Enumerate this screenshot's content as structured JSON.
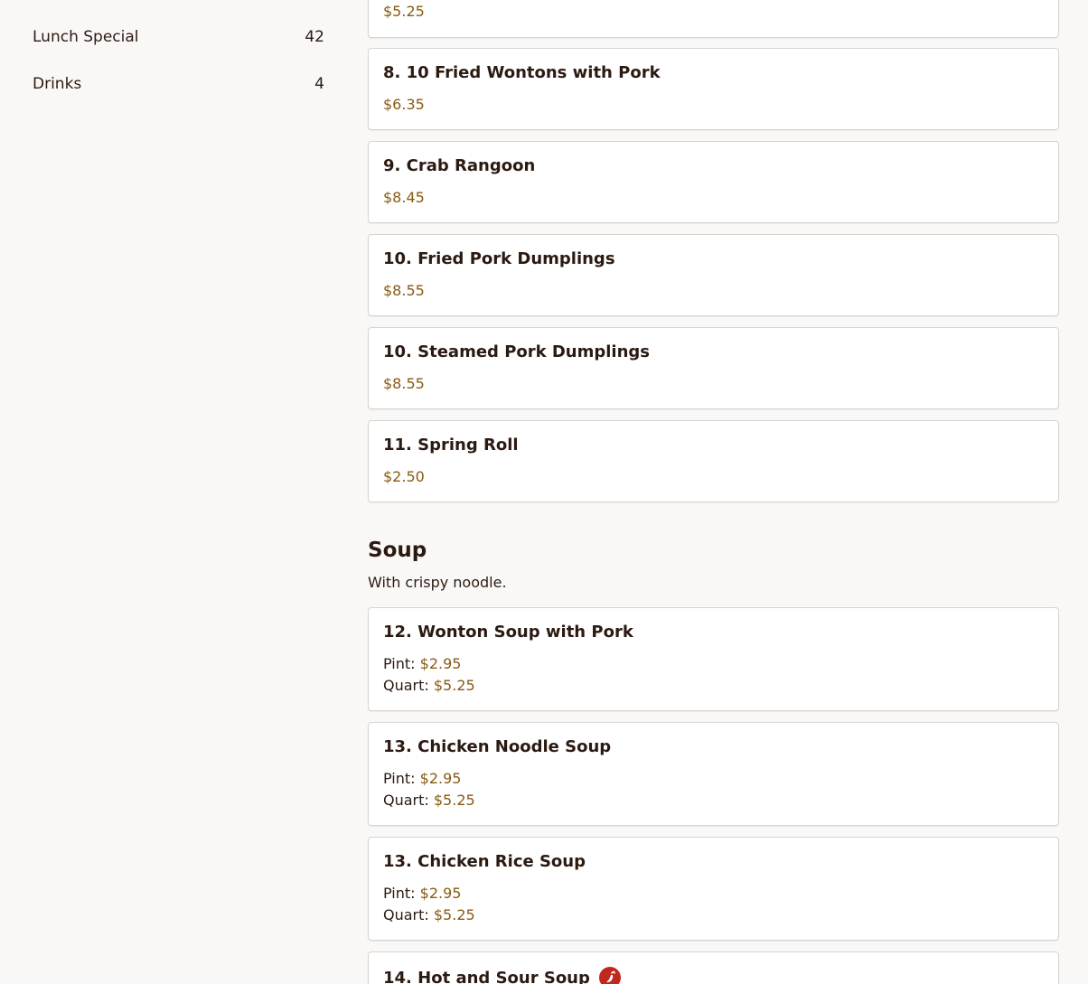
{
  "sidebar": {
    "items": [
      {
        "label": "Lunch Special",
        "count": "42"
      },
      {
        "label": "Drinks",
        "count": "4"
      }
    ]
  },
  "main": {
    "top_partial_price": "$5.25",
    "appetizer_items": [
      {
        "title": "8. 10 Fried Wontons with Pork",
        "price": "$6.35"
      },
      {
        "title": "9. Crab Rangoon",
        "price": "$8.45"
      },
      {
        "title": "10. Fried Pork Dumplings",
        "price": "$8.55"
      },
      {
        "title": "10. Steamed Pork Dumplings",
        "price": "$8.55"
      },
      {
        "title": "11. Spring Roll",
        "price": "$2.50"
      }
    ],
    "soup_section": {
      "title": "Soup",
      "subtitle": "With crispy noodle."
    },
    "soup_items": [
      {
        "title": "12. Wonton Soup with Pork",
        "pint_label": "Pint:",
        "pint_price": "$2.95",
        "quart_label": "Quart:",
        "quart_price": "$5.25"
      },
      {
        "title": "13. Chicken Noodle Soup",
        "pint_label": "Pint:",
        "pint_price": "$2.95",
        "quart_label": "Quart:",
        "quart_price": "$5.25"
      },
      {
        "title": "13. Chicken Rice Soup",
        "pint_label": "Pint:",
        "pint_price": "$2.95",
        "quart_label": "Quart:",
        "quart_price": "$5.25"
      }
    ],
    "last_partial_item": {
      "title": "14. Hot and Sour Soup",
      "icon": "spicy-pepper-icon"
    }
  },
  "colors": {
    "price": "#8a5a12",
    "spicy_badge": "#c0281e",
    "background": "#faf8f6"
  }
}
